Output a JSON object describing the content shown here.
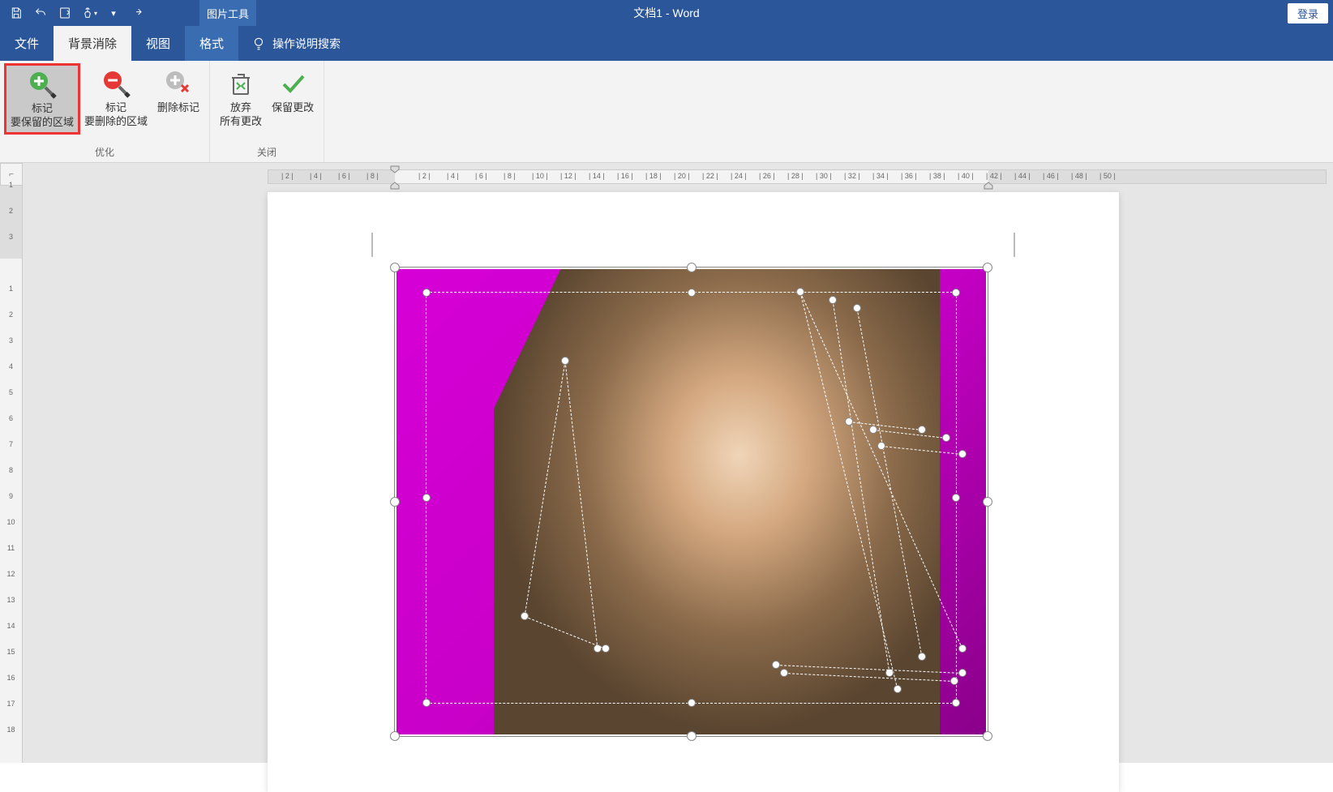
{
  "titlebar": {
    "doc_title": "文档1  -  Word",
    "context_tool": "图片工具",
    "login": "登录"
  },
  "tabs": {
    "file": "文件",
    "bg_remove": "背景消除",
    "view": "视图",
    "format": "格式",
    "tell_me": "操作说明搜索"
  },
  "ribbon": {
    "mark_keep": {
      "l1": "标记",
      "l2": "要保留的区域"
    },
    "mark_remove": {
      "l1": "标记",
      "l2": "要删除的区域"
    },
    "delete_mark": "删除标记",
    "discard": {
      "l1": "放弃",
      "l2": "所有更改"
    },
    "keep": "保留更改",
    "group_refine": "优化",
    "group_close": "关闭"
  },
  "hruler": {
    "left": [
      "8",
      "6",
      "4",
      "2"
    ],
    "right": [
      "2",
      "4",
      "6",
      "8",
      "10",
      "12",
      "14",
      "16",
      "18",
      "20",
      "22",
      "24",
      "26",
      "28",
      "30",
      "32",
      "34",
      "36",
      "38",
      "40",
      "42",
      "44",
      "46",
      "48",
      "50"
    ]
  },
  "vruler": {
    "top": [
      "3",
      "2",
      "1"
    ],
    "bottom": [
      "1",
      "2",
      "3",
      "4",
      "5",
      "6",
      "7",
      "8",
      "9",
      "10",
      "11",
      "12",
      "13",
      "14",
      "15",
      "16",
      "17",
      "18"
    ]
  },
  "icons": {
    "save": "save-icon",
    "undo": "undo-icon",
    "quickprint": "quickprint-icon",
    "touch": "touch-icon",
    "customize": "customize-icon",
    "redo": "redo-icon",
    "bulb": "lightbulb-icon"
  }
}
